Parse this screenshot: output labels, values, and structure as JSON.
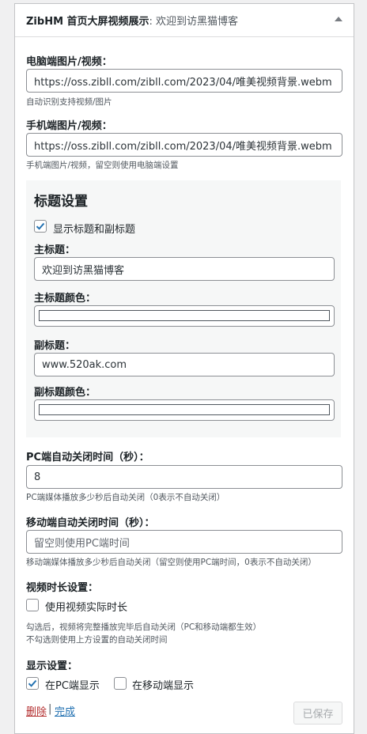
{
  "widget": {
    "title": "ZibHM 首页大屏视频展示",
    "title_sub": ": 欢迎到访黑猫博客"
  },
  "pc_media": {
    "label": "电脑端图片/视频：",
    "value": "https://oss.zibll.com/zibll.com/2023/04/唯美视频背景.webm",
    "hint": "自动识别支持视频/图片"
  },
  "mobile_media": {
    "label": "手机端图片/视频：",
    "value": "https://oss.zibll.com/zibll.com/2023/04/唯美视频背景.webm",
    "hint": "手机端图片/视频，留空则使用电脑端设置"
  },
  "title_settings": {
    "heading": "标题设置",
    "show_titles_label": "显示标题和副标题",
    "show_titles_checked": true,
    "main_title_label": "主标题：",
    "main_title_value": "欢迎到访黑猫博客",
    "main_title_color_label": "主标题颜色：",
    "subtitle_label": "副标题：",
    "subtitle_value": "www.520ak.com",
    "subtitle_color_label": "副标题颜色："
  },
  "pc_close": {
    "label": "PC端自动关闭时间（秒）：",
    "value": "8",
    "hint": "PC端媒体播放多少秒后自动关闭（0表示不自动关闭）"
  },
  "mobile_close": {
    "label": "移动端自动关闭时间（秒）：",
    "placeholder": "留空则使用PC端时间",
    "hint": "移动端媒体播放多少秒后自动关闭（留空则使用PC端时间，0表示不自动关闭）"
  },
  "video_duration": {
    "label": "视频时长设置：",
    "checkbox_label": "使用视频实际时长",
    "checked": false,
    "hint_line1": "勾选后，视频将完整播放完毕后自动关闭（PC和移动端都生效）",
    "hint_line2": "不勾选则使用上方设置的自动关闭时间"
  },
  "display": {
    "label": "显示设置：",
    "pc_label": "在PC端显示",
    "pc_checked": true,
    "mobile_label": "在移动端显示",
    "mobile_checked": false
  },
  "footer": {
    "delete_label": "删除",
    "separator": "|",
    "done_label": "完成",
    "saved_label": "已保存"
  },
  "colors": {
    "link_blue": "#2271b1",
    "delete_red": "#b32d2e",
    "check_blue": "#2271b1"
  }
}
